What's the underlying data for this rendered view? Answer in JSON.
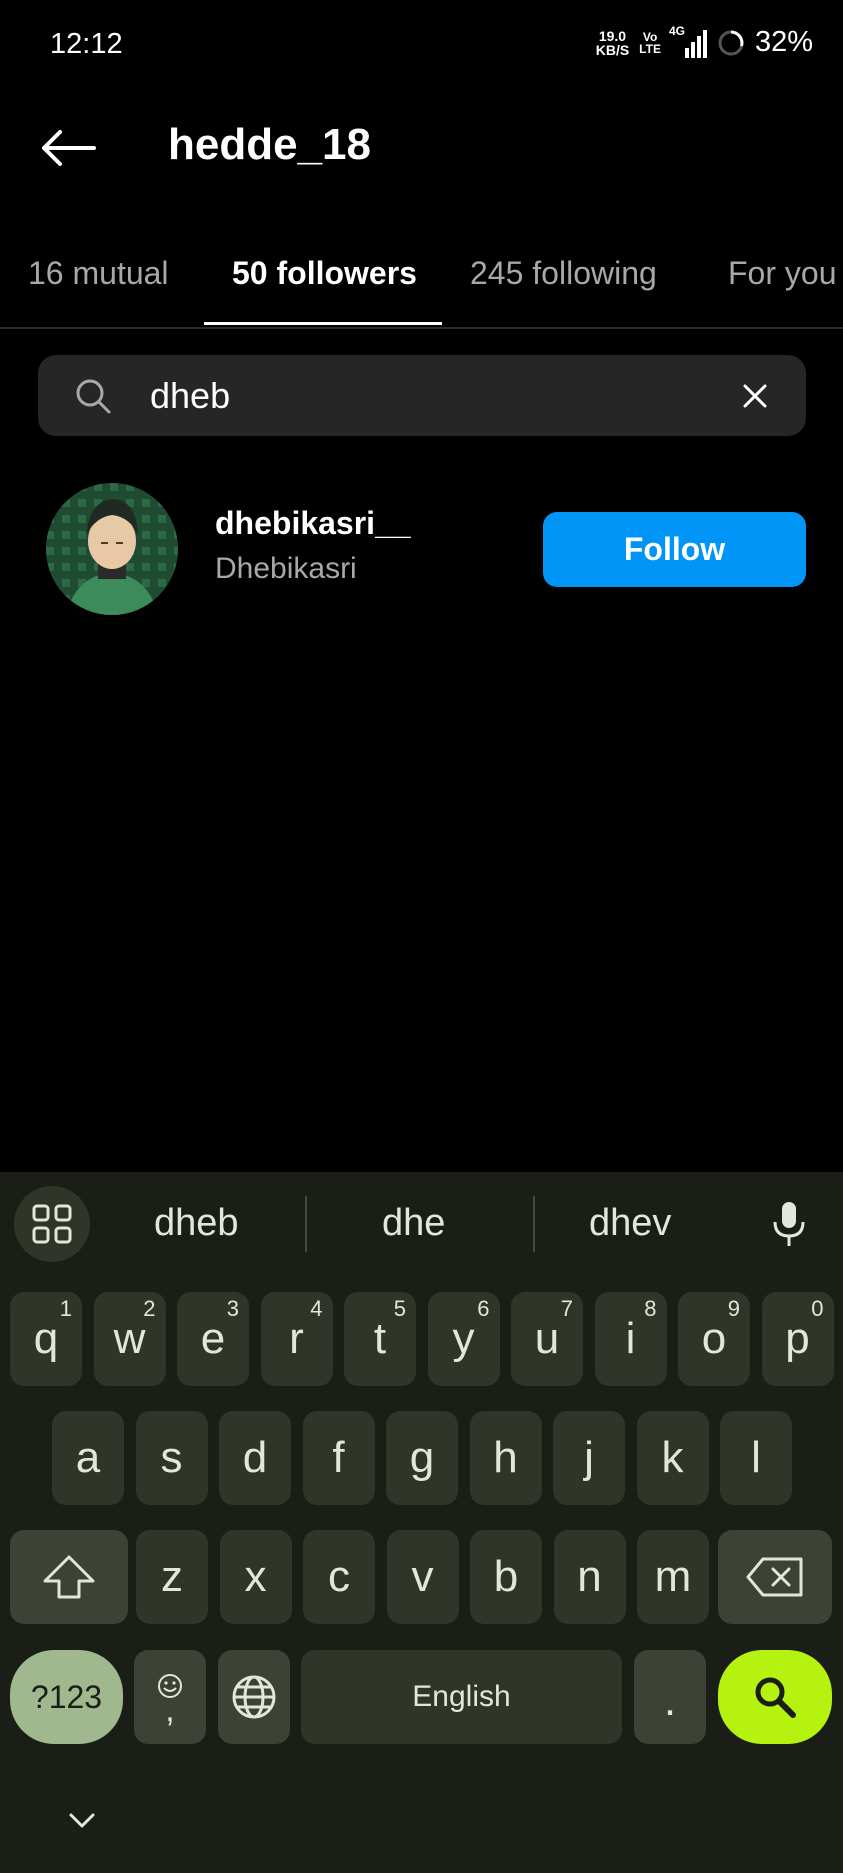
{
  "status_bar": {
    "time": "12:12",
    "net_speed_value": "19.0",
    "net_speed_unit": "KB/S",
    "volte_top": "Vo",
    "volte_bottom": "LTE",
    "network_type": "4G",
    "battery": "32%"
  },
  "header": {
    "title": "hedde_18"
  },
  "tabs": [
    {
      "label": "16 mutual",
      "active": false
    },
    {
      "label": "50 followers",
      "active": true
    },
    {
      "label": "245 following",
      "active": false
    },
    {
      "label": "For you",
      "active": false
    }
  ],
  "search": {
    "value": "dheb"
  },
  "results": [
    {
      "username": "dhebikasri__",
      "full_name": "Dhebikasri",
      "button_label": "Follow"
    }
  ],
  "keyboard": {
    "suggestions": [
      "dheb",
      "dhe",
      "dhev"
    ],
    "row1": [
      {
        "k": "q",
        "n": "1"
      },
      {
        "k": "w",
        "n": "2"
      },
      {
        "k": "e",
        "n": "3"
      },
      {
        "k": "r",
        "n": "4"
      },
      {
        "k": "t",
        "n": "5"
      },
      {
        "k": "y",
        "n": "6"
      },
      {
        "k": "u",
        "n": "7"
      },
      {
        "k": "i",
        "n": "8"
      },
      {
        "k": "o",
        "n": "9"
      },
      {
        "k": "p",
        "n": "0"
      }
    ],
    "row2": [
      "a",
      "s",
      "d",
      "f",
      "g",
      "h",
      "j",
      "k",
      "l"
    ],
    "row3": [
      "z",
      "x",
      "c",
      "v",
      "b",
      "n",
      "m"
    ],
    "symbols_key": "?123",
    "comma_key": ",",
    "space_label": "English",
    "period_key": "."
  },
  "colors": {
    "follow_button": "#0095f6",
    "search_key": "#b5f20f",
    "symbols_key": "#9fb88e",
    "keyboard_bg": "#1b1e17"
  },
  "icons": [
    "back-arrow-icon",
    "search-icon",
    "clear-icon",
    "apps-grid-icon",
    "microphone-icon",
    "shift-icon",
    "backspace-icon",
    "emoji-icon",
    "globe-icon",
    "keyboard-search-icon",
    "hide-keyboard-icon"
  ]
}
